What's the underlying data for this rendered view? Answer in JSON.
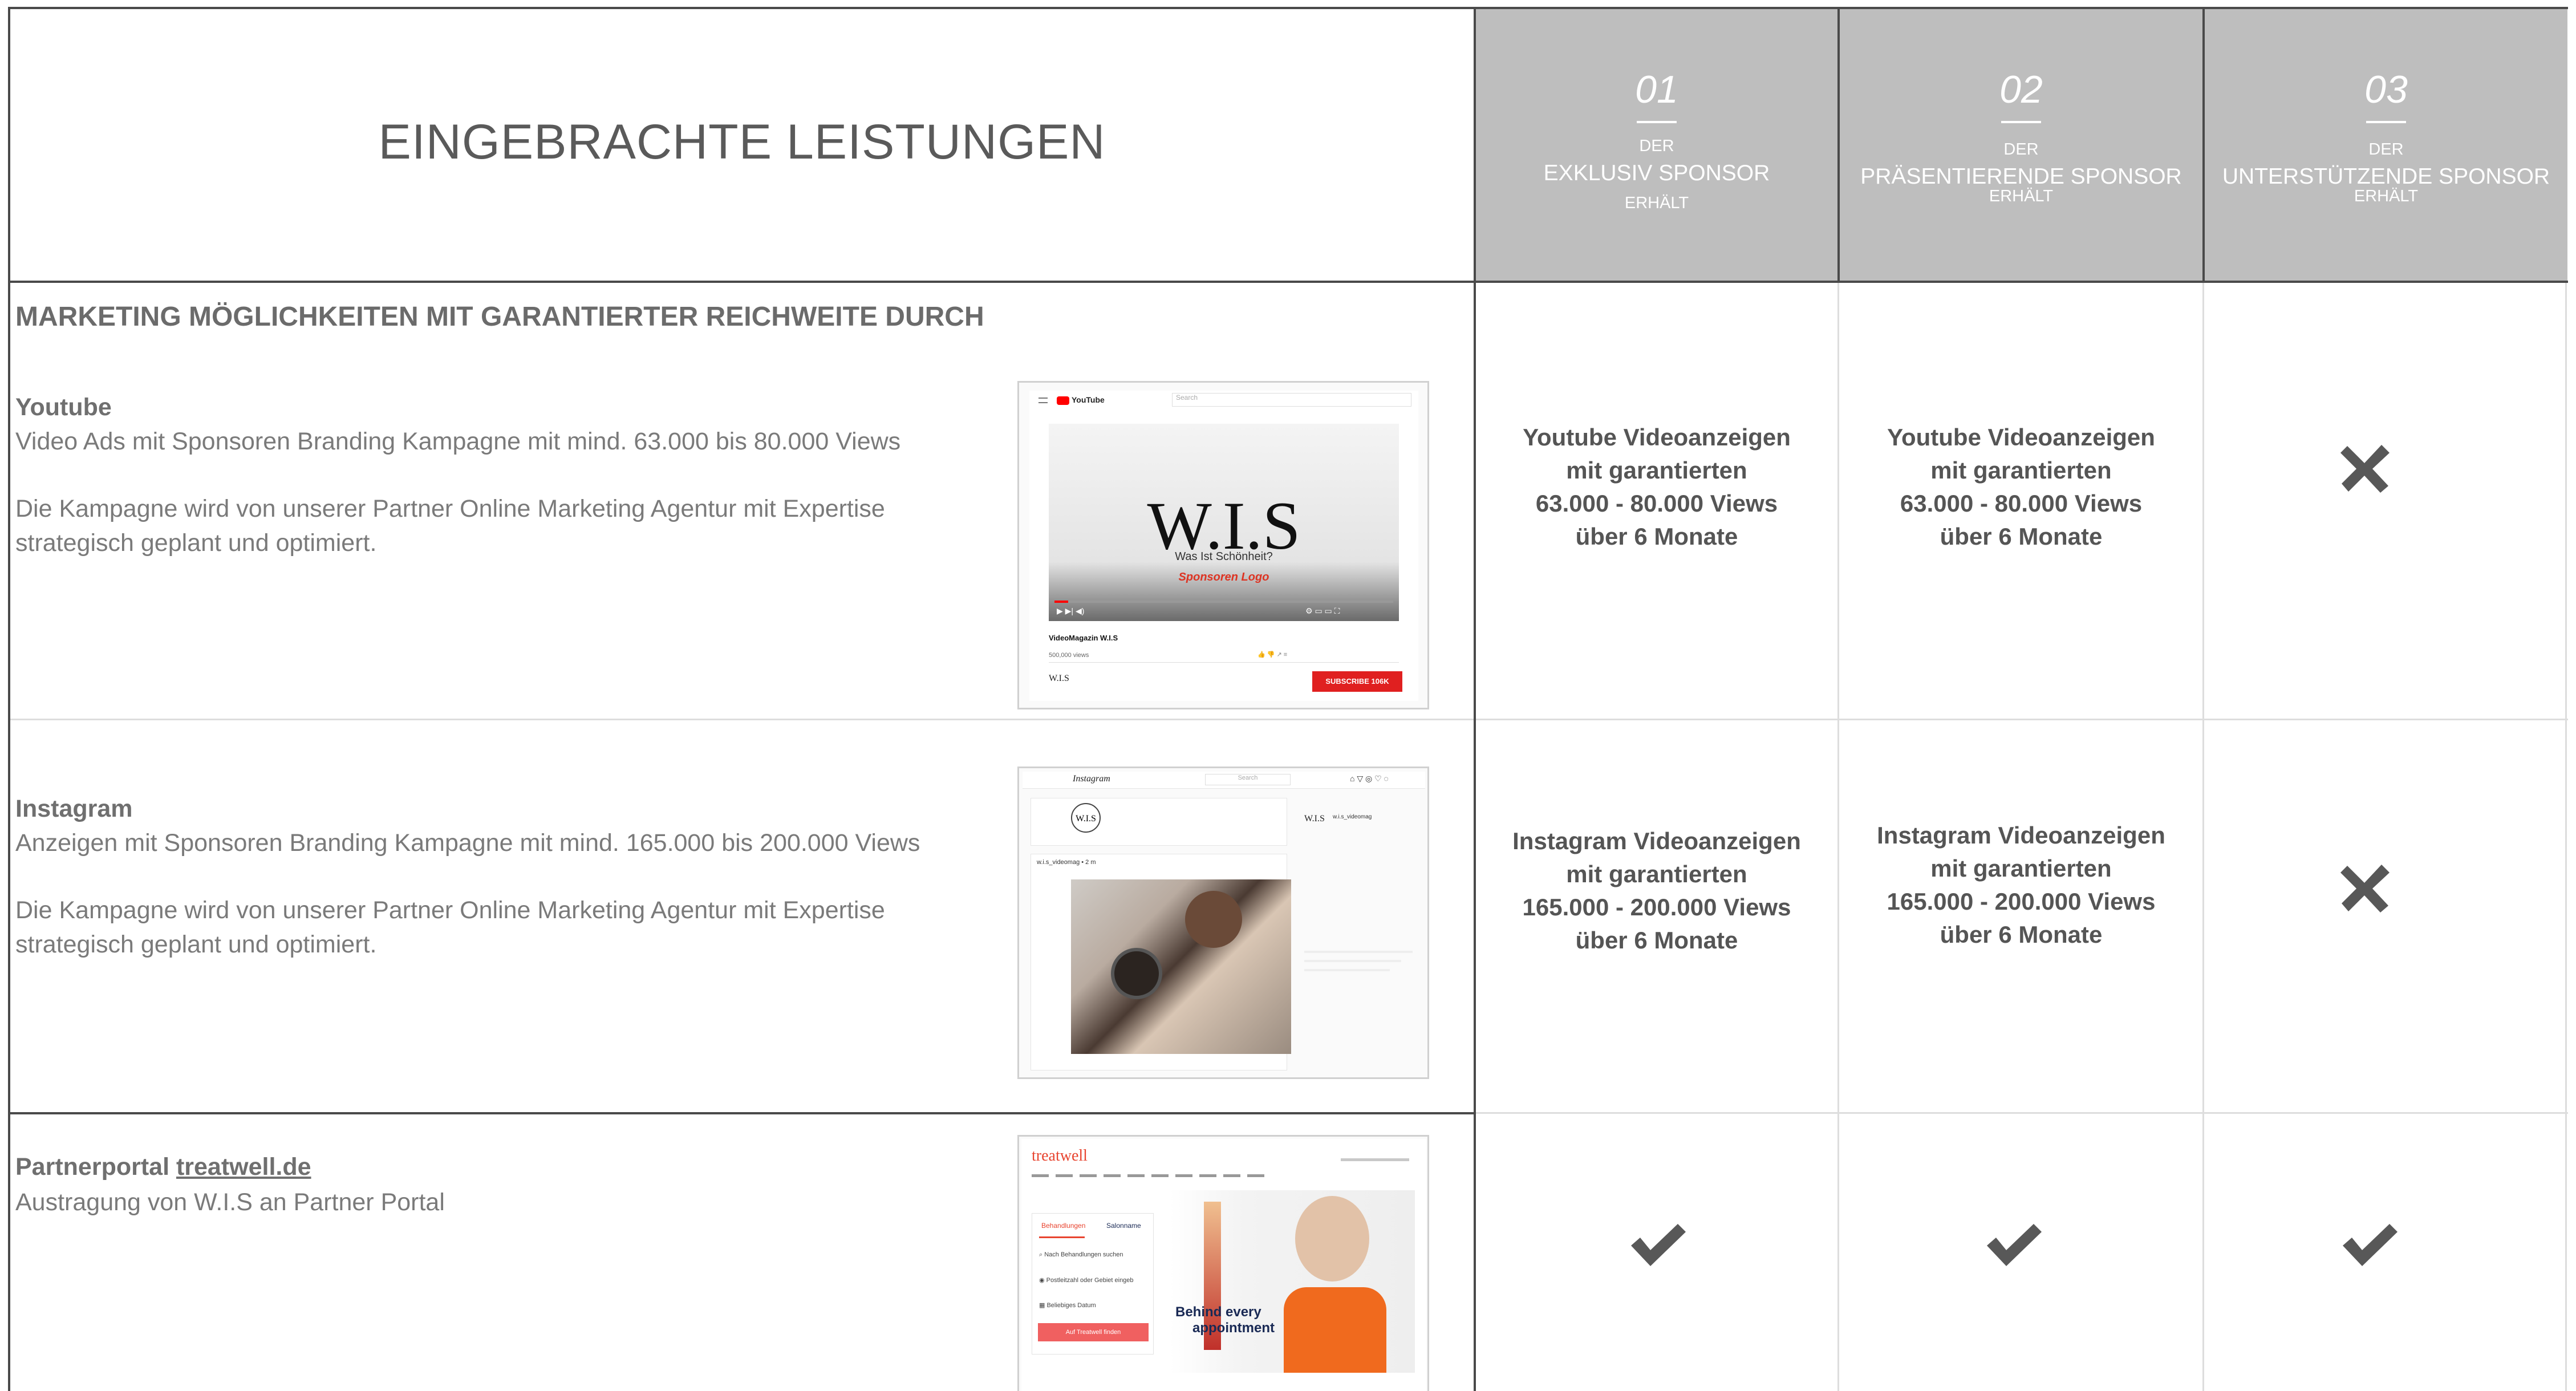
{
  "header": {
    "title": "EINGEBRACHTE LEISTUNGEN",
    "columns": [
      {
        "number": "01",
        "pre": "DER",
        "name": "EXKLUSIV SPONSOR",
        "post": "ERHÄLT"
      },
      {
        "number": "02",
        "pre": "DER",
        "name": "PRÄSENTIERENDE SPONSOR",
        "post": "ERHÄLT"
      },
      {
        "number": "03",
        "pre": "DER",
        "name": "UNTERSTÜTZENDE SPONSOR",
        "post": "ERHÄLT"
      }
    ]
  },
  "section_title": "MARKETING MÖGLICHKEITEN MIT GARANTIERTER REICHWEITE DURCH",
  "rows": [
    {
      "title": "Youtube",
      "line1": "Video Ads mit Sponsoren Branding Kampagne mit mind. 63.000 bis 80.000 Views",
      "line2": "Die Kampagne wird von unserer Partner Online Marketing Agentur mit Expertise",
      "line3": "strategisch geplant und optimiert.",
      "cells": [
        {
          "l1": "Youtube Videoanzeigen",
          "l2": "mit garantierten",
          "l3": "63.000 - 80.000 Views",
          "l4": "über 6 Monate"
        },
        {
          "l1": "Youtube Videoanzeigen",
          "l2": "mit garantierten",
          "l3": "63.000 - 80.000 Views",
          "l4": "über 6 Monate"
        }
      ],
      "third": "x-mark"
    },
    {
      "title": "Instagram",
      "line1": "Anzeigen mit Sponsoren Branding Kampagne mit mind. 165.000 bis 200.000 Views",
      "line2": "Die Kampagne wird von unserer Partner Online Marketing Agentur mit Expertise",
      "line3": "strategisch geplant und optimiert.",
      "cells": [
        {
          "l1": "Instagram Videoanzeigen",
          "l2": "mit garantierten",
          "l3": "165.000 - 200.000 Views",
          "l4": "über 6 Monate"
        },
        {
          "l1": "Instagram Videoanzeigen",
          "l2": "mit garantierten",
          "l3": "165.000 - 200.000 Views",
          "l4": "über 6 Monate"
        }
      ],
      "third": "x-mark"
    },
    {
      "title_prefix": "Partnerportal ",
      "title_link": "treatwell.de",
      "line1": "Austragung von W.I.S an Partner Portal",
      "marks": [
        "check-mark",
        "check-mark",
        "check-mark"
      ]
    }
  ],
  "shots": {
    "youtube": {
      "brand": "YouTube",
      "search": "Search",
      "logo": "W.I.S",
      "tagline": "Was Ist Schönheit?",
      "sponsor": "Sponsoren Logo",
      "video_title": "VideoMagazin W.I.S",
      "views": "500,000 views",
      "channel": "W.I.S",
      "subscribe": "SUBSCRIBE 106K"
    },
    "instagram": {
      "brand": "Instagram",
      "search": "Search",
      "logo": "W.I.S",
      "user": "w.i.s_videomag",
      "handle": "w.i.s_videomag • 2 m"
    },
    "treatwell": {
      "brand": "treatwell",
      "tab1": "Behandlungen",
      "tab2": "Salonname",
      "field1": "Nach Behandlungen suchen",
      "field2": "Postleitzahl oder Gebiet eingeb",
      "field3": "Beliebiges Datum",
      "button": "Auf Treatwell finden",
      "headline1": "Behind every",
      "headline2": "appointment"
    }
  },
  "colors": {
    "header_bg": "#bebebe",
    "accent_red": "#e8442f",
    "youtube_red": "#ff0000"
  }
}
